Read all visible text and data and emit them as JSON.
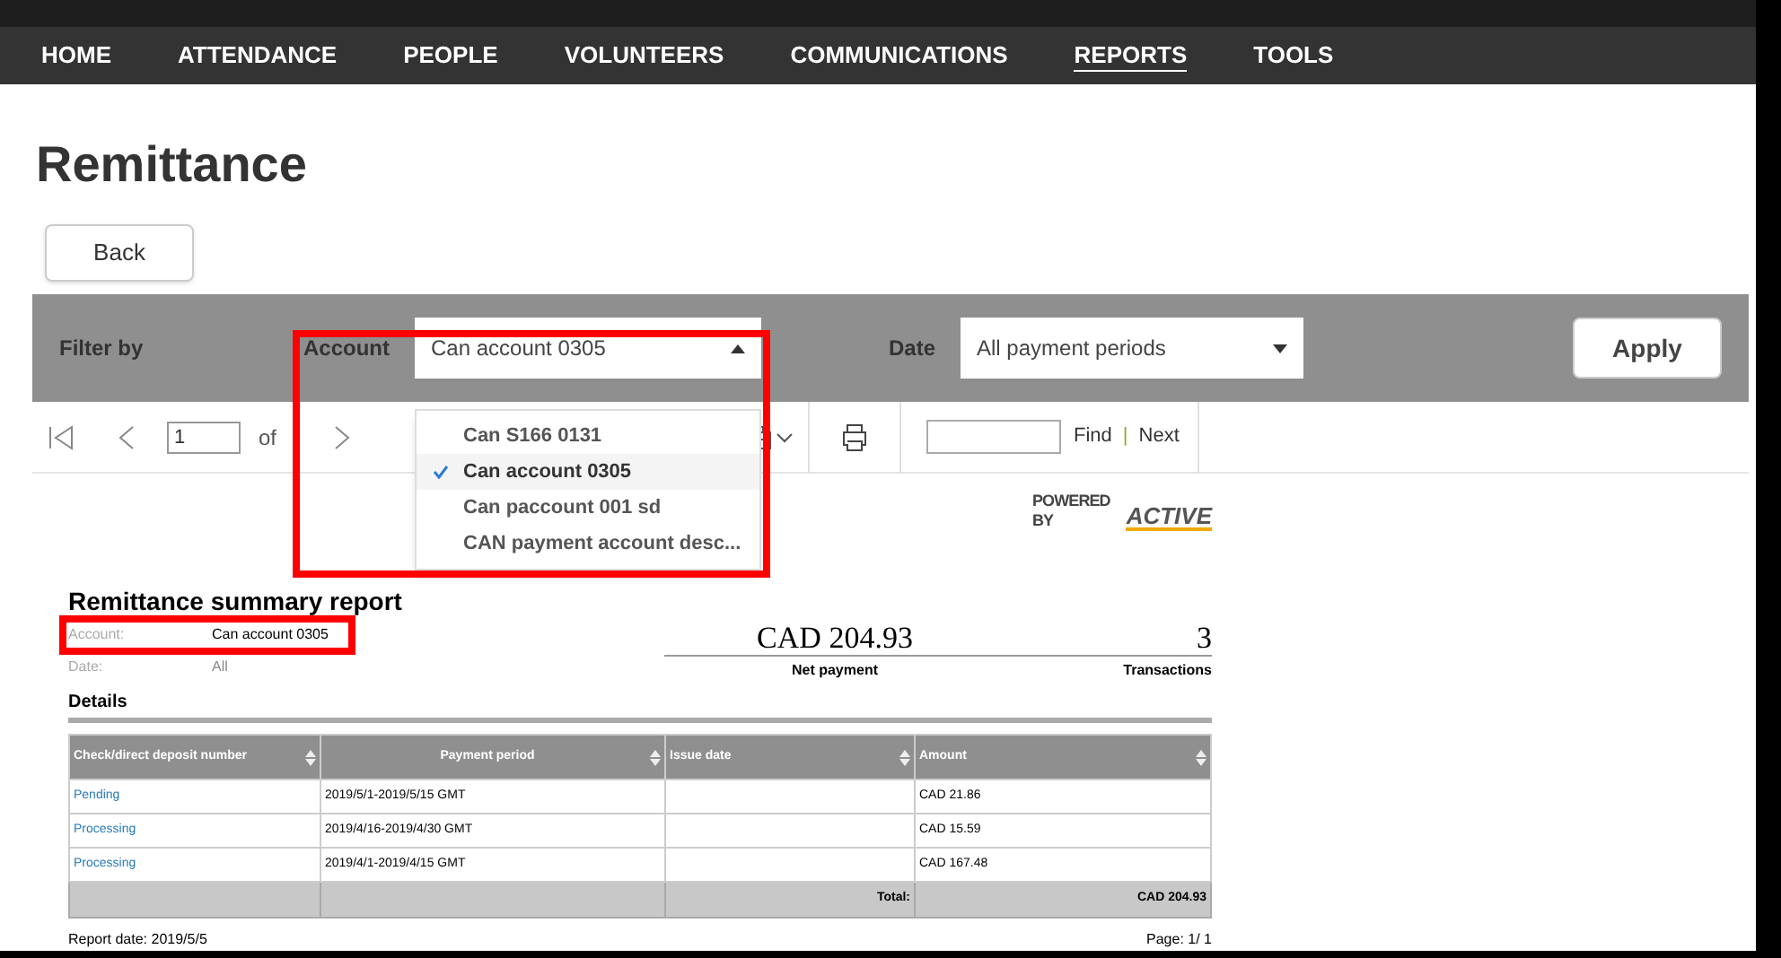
{
  "nav": [
    {
      "label": "HOME",
      "selected": false
    },
    {
      "label": "ATTENDANCE",
      "selected": false
    },
    {
      "label": "PEOPLE",
      "selected": false
    },
    {
      "label": "VOLUNTEERS",
      "selected": false
    },
    {
      "label": "COMMUNICATIONS",
      "selected": false
    },
    {
      "label": "REPORTS",
      "selected": true
    },
    {
      "label": "TOOLS",
      "selected": false
    }
  ],
  "page_title": "Remittance",
  "back_button": "Back",
  "filter": {
    "label": "Filter by",
    "account_label": "Account",
    "account_value": "Can account 0305",
    "date_label": "Date",
    "date_value": "All payment periods",
    "apply": "Apply"
  },
  "account_dropdown": [
    {
      "label": "Can S166 0131",
      "selected": false
    },
    {
      "label": "Can account 0305",
      "selected": true
    },
    {
      "label": "Can paccount 001 sd",
      "selected": false
    },
    {
      "label": "CAN payment account desc...",
      "selected": false
    }
  ],
  "toolbar": {
    "page": "1",
    "of": "of",
    "find": "Find",
    "separator": "|",
    "next": "Next"
  },
  "powered_by": "POWERED BY",
  "brand": "ACTIVE",
  "report": {
    "title": "Remittance summary report",
    "account_label": "Account:",
    "account_value": "Can account 0305",
    "date_label": "Date:",
    "date_value": "All",
    "net_payment": "CAD 204.93",
    "net_payment_label": "Net payment",
    "transactions": "3",
    "transactions_label": "Transactions",
    "details": "Details",
    "columns": [
      "Check/direct deposit number",
      "Payment period",
      "Issue date",
      "Amount"
    ],
    "rows": [
      [
        "Pending",
        "2019/5/1-2019/5/15 GMT",
        "",
        "CAD 21.86"
      ],
      [
        "Processing",
        "2019/4/16-2019/4/30 GMT",
        "",
        "CAD 15.59"
      ],
      [
        "Processing",
        "2019/4/1-2019/4/15 GMT",
        "",
        "CAD 167.48"
      ]
    ],
    "total_label": "Total:",
    "total": "CAD 204.93",
    "report_date": "Report date: 2019/5/5",
    "page": "Page: 1/ 1"
  }
}
